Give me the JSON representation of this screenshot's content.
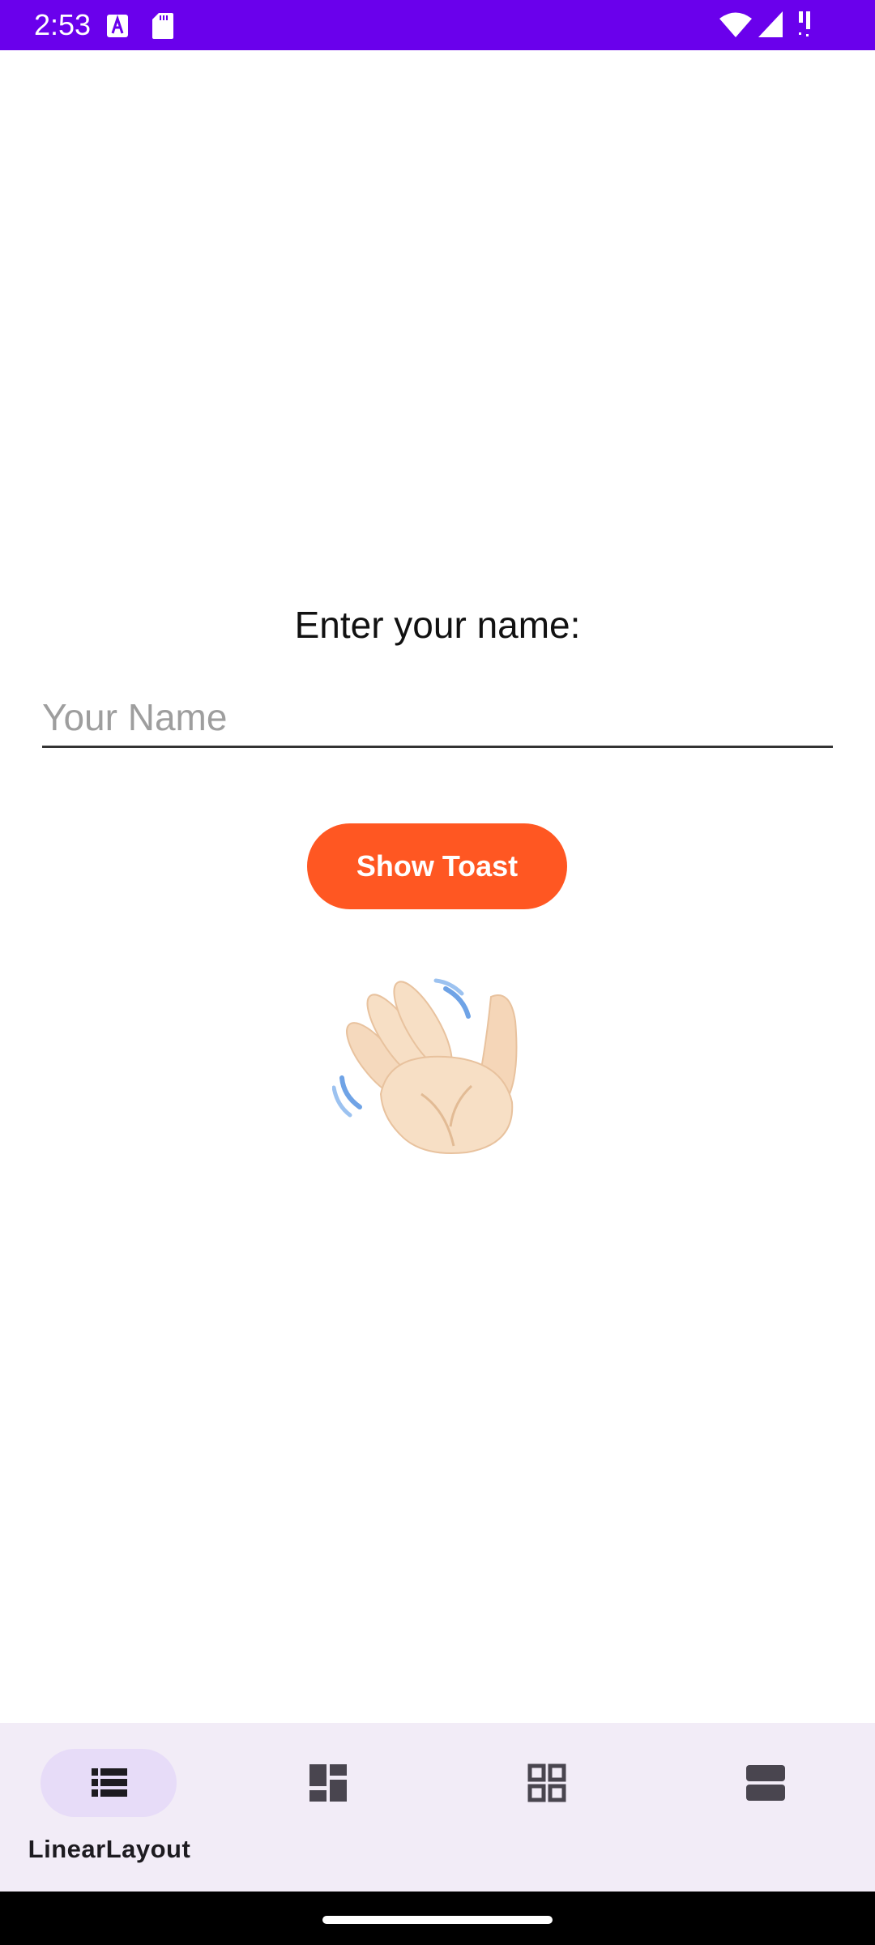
{
  "status_bar": {
    "time": "2:53",
    "background": "#6a00ec",
    "icons": [
      "a-notification-icon",
      "sd-card-icon",
      "wifi-icon",
      "cell-signal-icon",
      "battery-icon"
    ]
  },
  "form": {
    "prompt": "Enter your name:",
    "input_value": "",
    "input_placeholder": "Your Name",
    "button_label": "Show Toast",
    "button_color": "#ff5722"
  },
  "illustration": {
    "icon": "waving-hand-icon"
  },
  "bottom_nav": {
    "background": "#f2ecf7",
    "items": [
      {
        "label": "LinearLayout",
        "icon": "linear-list-icon",
        "selected": true
      },
      {
        "label": "",
        "icon": "dashboard-icon",
        "selected": false
      },
      {
        "label": "",
        "icon": "grid-icon",
        "selected": false
      },
      {
        "label": "",
        "icon": "stacked-rows-icon",
        "selected": false
      }
    ]
  }
}
